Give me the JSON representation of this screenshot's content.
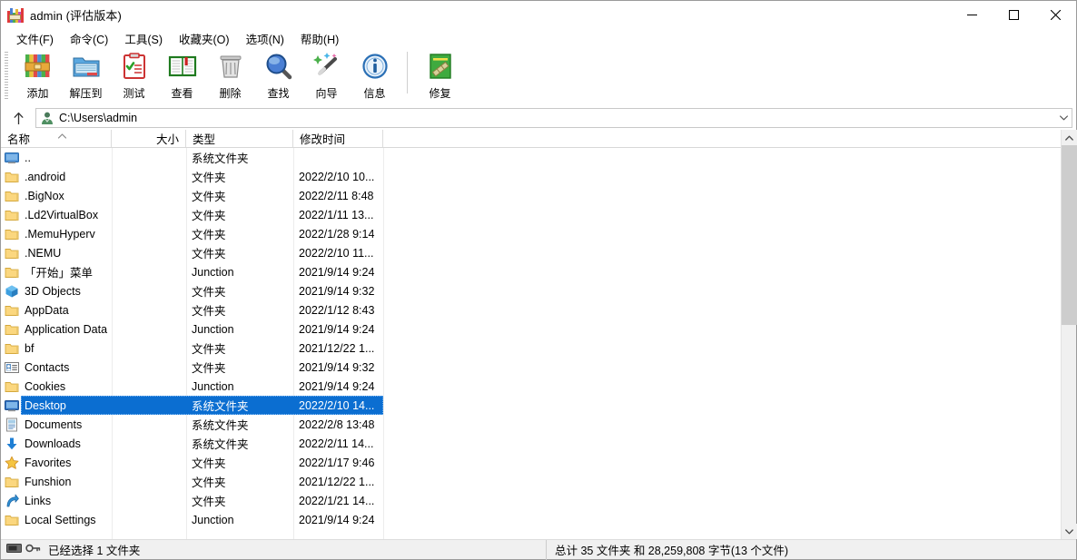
{
  "window": {
    "title": "admin (评估版本)",
    "icon": "winrar-books-icon",
    "controls": {
      "minimize": "—",
      "maximize": "□",
      "close": "✕"
    }
  },
  "menubar": {
    "items": [
      {
        "label": "文件(F)",
        "name": "menu-file"
      },
      {
        "label": "命令(C)",
        "name": "menu-commands"
      },
      {
        "label": "工具(S)",
        "name": "menu-tools"
      },
      {
        "label": "收藏夹(O)",
        "name": "menu-favorites"
      },
      {
        "label": "选项(N)",
        "name": "menu-options"
      },
      {
        "label": "帮助(H)",
        "name": "menu-help"
      }
    ]
  },
  "toolbar": {
    "buttons": [
      {
        "label": "添加",
        "icon": "add-archive-icon"
      },
      {
        "label": "解压到",
        "icon": "extract-to-icon"
      },
      {
        "label": "测试",
        "icon": "test-clipboard-icon"
      },
      {
        "label": "查看",
        "icon": "view-book-icon"
      },
      {
        "label": "删除",
        "icon": "delete-trash-icon"
      },
      {
        "label": "查找",
        "icon": "find-magnifier-icon"
      },
      {
        "label": "向导",
        "icon": "wizard-wand-icon"
      },
      {
        "label": "信息",
        "icon": "info-icon"
      }
    ],
    "buttons_after_separator": [
      {
        "label": "修复",
        "icon": "repair-icon"
      }
    ]
  },
  "addressbar": {
    "up_button": "up-arrow-icon",
    "path_icon": "user-folder-icon",
    "path": "C:\\Users\\admin",
    "dropdown": "chevron-down-icon"
  },
  "columns": [
    {
      "label": "名称",
      "align": "left",
      "sorted": "asc"
    },
    {
      "label": "大小",
      "align": "right"
    },
    {
      "label": "类型",
      "align": "left"
    },
    {
      "label": "修改时间",
      "align": "left"
    }
  ],
  "files": [
    {
      "name": "..",
      "size": "",
      "type": "系统文件夹",
      "modified": "",
      "icon": "parent-folder-icon",
      "selected": false
    },
    {
      "name": ".android",
      "size": "",
      "type": "文件夹",
      "modified": "2022/2/10 10...",
      "icon": "folder-icon",
      "selected": false
    },
    {
      "name": ".BigNox",
      "size": "",
      "type": "文件夹",
      "modified": "2022/2/11 8:48",
      "icon": "folder-icon",
      "selected": false
    },
    {
      "name": ".Ld2VirtualBox",
      "size": "",
      "type": "文件夹",
      "modified": "2022/1/11 13...",
      "icon": "folder-icon",
      "selected": false
    },
    {
      "name": ".MemuHyperv",
      "size": "",
      "type": "文件夹",
      "modified": "2022/1/28 9:14",
      "icon": "folder-icon",
      "selected": false
    },
    {
      "name": ".NEMU",
      "size": "",
      "type": "文件夹",
      "modified": "2022/2/10 11...",
      "icon": "folder-icon",
      "selected": false
    },
    {
      "name": "「开始」菜单",
      "size": "",
      "type": "Junction",
      "modified": "2021/9/14 9:24",
      "icon": "folder-icon",
      "selected": false
    },
    {
      "name": "3D Objects",
      "size": "",
      "type": "文件夹",
      "modified": "2021/9/14 9:32",
      "icon": "3d-objects-icon",
      "selected": false
    },
    {
      "name": "AppData",
      "size": "",
      "type": "文件夹",
      "modified": "2022/1/12 8:43",
      "icon": "folder-icon",
      "selected": false
    },
    {
      "name": "Application Data",
      "size": "",
      "type": "Junction",
      "modified": "2021/9/14 9:24",
      "icon": "folder-icon",
      "selected": false
    },
    {
      "name": "bf",
      "size": "",
      "type": "文件夹",
      "modified": "2021/12/22 1...",
      "icon": "folder-icon",
      "selected": false
    },
    {
      "name": "Contacts",
      "size": "",
      "type": "文件夹",
      "modified": "2021/9/14 9:32",
      "icon": "contacts-icon",
      "selected": false
    },
    {
      "name": "Cookies",
      "size": "",
      "type": "Junction",
      "modified": "2021/9/14 9:24",
      "icon": "folder-icon",
      "selected": false
    },
    {
      "name": "Desktop",
      "size": "",
      "type": "系统文件夹",
      "modified": "2022/2/10 14...",
      "icon": "desktop-icon",
      "selected": true
    },
    {
      "name": "Documents",
      "size": "",
      "type": "系统文件夹",
      "modified": "2022/2/8 13:48",
      "icon": "documents-icon",
      "selected": false
    },
    {
      "name": "Downloads",
      "size": "",
      "type": "系统文件夹",
      "modified": "2022/2/11 14...",
      "icon": "downloads-icon",
      "selected": false
    },
    {
      "name": "Favorites",
      "size": "",
      "type": "文件夹",
      "modified": "2022/1/17 9:46",
      "icon": "favorites-star-icon",
      "selected": false
    },
    {
      "name": "Funshion",
      "size": "",
      "type": "文件夹",
      "modified": "2021/12/22 1...",
      "icon": "folder-icon",
      "selected": false
    },
    {
      "name": "Links",
      "size": "",
      "type": "文件夹",
      "modified": "2022/1/21 14...",
      "icon": "links-icon",
      "selected": false
    },
    {
      "name": "Local Settings",
      "size": "",
      "type": "Junction",
      "modified": "2021/9/14 9:24",
      "icon": "folder-icon",
      "selected": false
    }
  ],
  "statusbar": {
    "left_icons": [
      "drive-icon",
      "key-icon"
    ],
    "left_text": "已经选择 1 文件夹",
    "right_text": "总计 35 文件夹 和 28,259,808 字节(13 个文件)"
  },
  "colors": {
    "selection": "#0b6ed1",
    "folder": "#fbd77f",
    "window_bg": "#ffffff",
    "statusbar_bg": "#f0f0f0"
  }
}
